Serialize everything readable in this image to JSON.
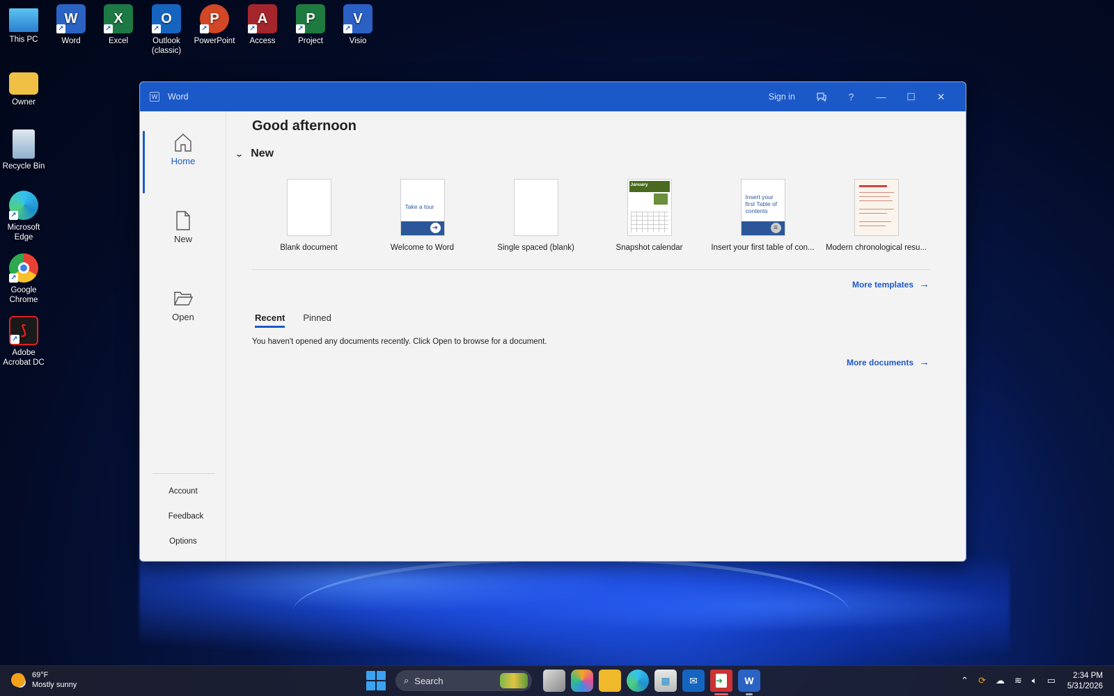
{
  "desktop": {
    "icons": [
      {
        "label": "This PC",
        "letter": "",
        "color": "#3a8fd8"
      },
      {
        "label": "Word",
        "letter": "W",
        "color": "#2b63c4"
      },
      {
        "label": "Excel",
        "letter": "X",
        "color": "#1e7a45"
      },
      {
        "label": "Outlook (classic)",
        "letter": "O",
        "color": "#1565c0"
      },
      {
        "label": "PowerPoint",
        "letter": "P",
        "color": "#d24726"
      },
      {
        "label": "Access",
        "letter": "A",
        "color": "#a4262c"
      },
      {
        "label": "Project",
        "letter": "P",
        "color": "#1f7a3f"
      },
      {
        "label": "Visio",
        "letter": "V",
        "color": "#2b60c4"
      },
      {
        "label": "Owner",
        "letter": "",
        "color": "#f0c044"
      },
      {
        "label": "Recycle Bin",
        "letter": "",
        "color": "#7aa5c8"
      },
      {
        "label": "Microsoft Edge",
        "letter": "",
        "color": "#1d8fce"
      },
      {
        "label": "Google Chrome",
        "letter": "",
        "color": "#e84134"
      },
      {
        "label": "Adobe Acrobat DC",
        "letter": "",
        "color": "#1a1a1a"
      }
    ]
  },
  "window": {
    "title": "Word",
    "sign_in": "Sign in",
    "help": "?",
    "minimize": "—",
    "maximize": "☐",
    "close": "✕"
  },
  "sidebar": {
    "home": "Home",
    "new": "New",
    "open": "Open",
    "account": "Account",
    "feedback": "Feedback",
    "options": "Options"
  },
  "main": {
    "greeting": "Good afternoon",
    "new_section": "New",
    "templates": [
      "Blank document",
      "Welcome to Word",
      "Single spaced (blank)",
      "Snapshot calendar",
      "Insert your first table of con...",
      "Modern chronological resu..."
    ],
    "thumb_tour_text": "Take a tour",
    "thumb_toc_text": "Insert your first Table of contents",
    "thumb_cal_text": "January",
    "more_templates": "More templates",
    "tabs": [
      "Recent",
      "Pinned"
    ],
    "empty_message": "You haven't opened any documents recently. Click Open to browse for a document.",
    "more_documents": "More documents"
  },
  "taskbar": {
    "temperature": "69°F",
    "weather": "Mostly sunny",
    "search_placeholder": "Search",
    "time": "2:34 PM",
    "date": "5/31/2026"
  },
  "colors": {
    "accent": "#1c59c8",
    "titlebar": "#1c59c8"
  }
}
